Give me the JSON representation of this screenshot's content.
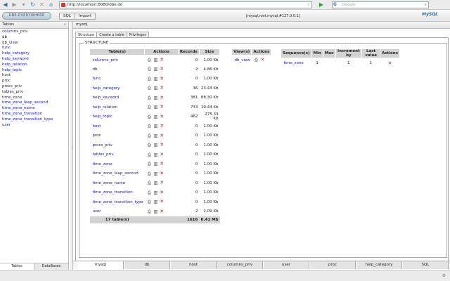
{
  "browser": {
    "url": "http://localhost:8080/dbe.do",
    "search_placeholder": "Google",
    "search_engine_letter": "G"
  },
  "app": {
    "logo_text": "DBE-EVERYWHERE",
    "menu": [
      "SQL",
      "Import"
    ],
    "connection": "[mysql,root,mysql,#127.0.0.1]",
    "brand": "MySQL"
  },
  "left": {
    "title": "Tables",
    "collapse": "«",
    "items": [
      "columns_priv",
      "db",
      "db_view",
      "func",
      "help_category",
      "help_keyword",
      "help_relation",
      "help_topic",
      "host",
      "proc",
      "procs_priv",
      "tables_priv",
      "time_zone",
      "time_zone_leap_second",
      "time_zone_name",
      "time_zone_transition",
      "time_zone_transition_type",
      "user"
    ],
    "tabs": [
      "Tables",
      "DataBases"
    ]
  },
  "main": {
    "title": "mysql",
    "subtabs": [
      "Structure",
      "Create a table",
      "Privileges"
    ],
    "legend": "STRUCTURE",
    "tables": {
      "headers": [
        "Table(s)",
        "Actions",
        "Records",
        "Size"
      ],
      "rows": [
        {
          "name": "columns_priv",
          "records": "0",
          "size": "1.00 Kb"
        },
        {
          "name": "db",
          "records": "2",
          "size": "4.86 Kb"
        },
        {
          "name": "func",
          "records": "0",
          "size": "1.00 Kb"
        },
        {
          "name": "help_category",
          "records": "36",
          "size": "23.43 Kb"
        },
        {
          "name": "help_keyword",
          "records": "381",
          "size": "88.30 Kb"
        },
        {
          "name": "help_relation",
          "records": "733",
          "size": "19.44 Kb"
        },
        {
          "name": "help_topic",
          "records": "462",
          "size": "275.33 Kb"
        },
        {
          "name": "host",
          "records": "0",
          "size": "1.00 Kb"
        },
        {
          "name": "proc",
          "records": "0",
          "size": "1.00 Kb"
        },
        {
          "name": "procs_priv",
          "records": "0",
          "size": "1.00 Kb"
        },
        {
          "name": "tables_priv",
          "records": "0",
          "size": "1.00 Kb"
        },
        {
          "name": "time_zone",
          "records": "0",
          "size": "1.00 Kb"
        },
        {
          "name": "time_zone_leap_second",
          "records": "0",
          "size": "1.00 Kb"
        },
        {
          "name": "time_zone_name",
          "records": "0",
          "size": "1.00 Kb"
        },
        {
          "name": "time_zone_transition",
          "records": "0",
          "size": "1.00 Kb"
        },
        {
          "name": "time_zone_transition_type",
          "records": "0",
          "size": "1.00 Kb"
        },
        {
          "name": "user",
          "records": "2",
          "size": "2.09 Kb"
        }
      ],
      "footer": {
        "count": "17 table(s)",
        "records": "1616",
        "size": "0.41 Mb"
      }
    },
    "views": {
      "headers": [
        "View(s)",
        "Actions"
      ],
      "rows": [
        {
          "name": "db_view"
        }
      ]
    },
    "sequences": {
      "headers": [
        "Sequence(s)",
        "Min",
        "Max",
        "Increment by",
        "Last value",
        "Actions"
      ],
      "rows": [
        {
          "name": "time_zone",
          "min": "1",
          "max": "",
          "increment": "1",
          "last": "1"
        }
      ]
    }
  },
  "bottom_tabs": [
    "mysql",
    "db",
    "host",
    "columns_priv",
    "user",
    "proc",
    "help_category",
    "SQL"
  ],
  "status": "⚙"
}
